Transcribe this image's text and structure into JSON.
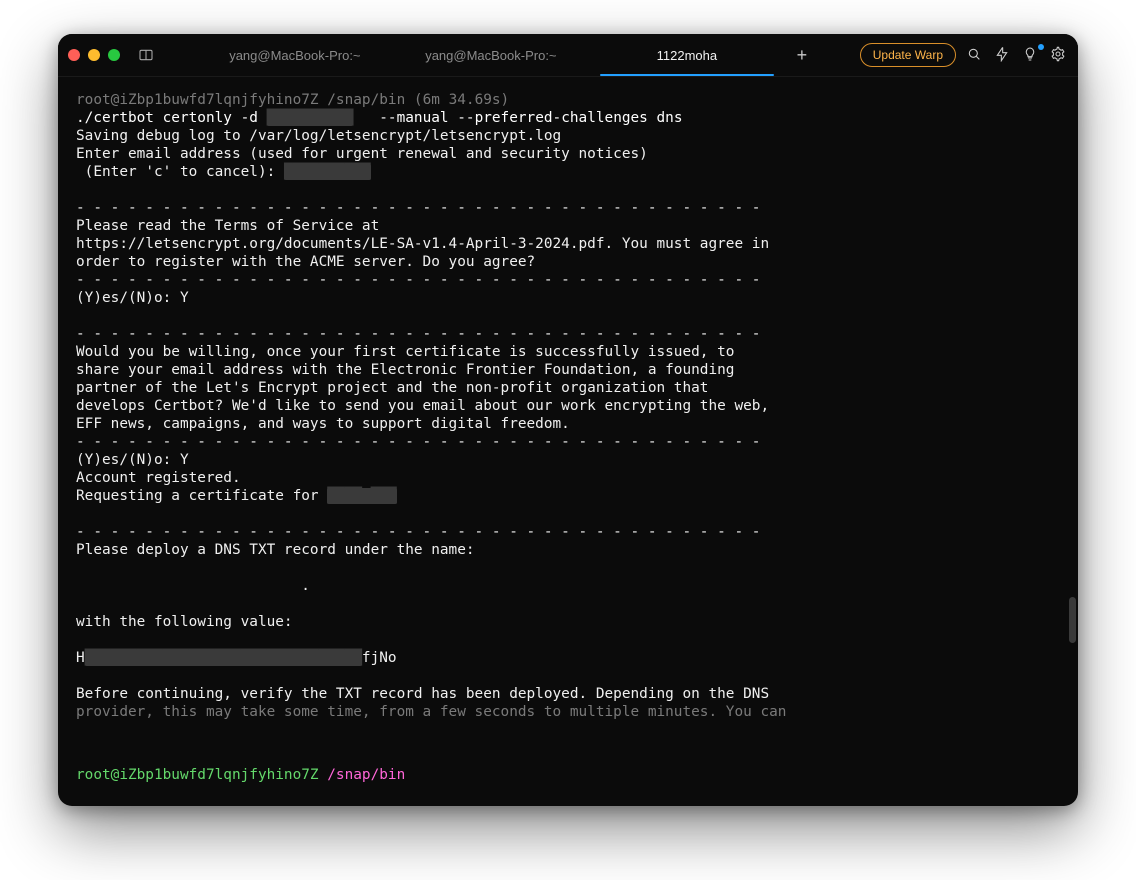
{
  "titlebar": {
    "tabs": [
      {
        "label": "yang@MacBook-Pro:~"
      },
      {
        "label": "yang@MacBook-Pro:~"
      },
      {
        "label": "1122moha"
      }
    ],
    "active_tab_index": 2,
    "update_label": "Update Warp",
    "newtab_glyph": "+"
  },
  "session": {
    "header_user_host": "root@iZbp1buwfd7lqnjfyhino7Z",
    "header_path": "/snap/bin",
    "header_timing": "(6m 34.69s)",
    "command_prefix": "./certbot certonly -d",
    "command_suffix": "--manual --preferred-challenges dns",
    "redacted_domain": "██████████",
    "lines": {
      "l1": "Saving debug log to /var/log/letsencrypt/letsencrypt.log",
      "l2": "Enter email address (used for urgent renewal and security notices)",
      "l3": " (Enter 'c' to cancel): ",
      "redacted_email": "██████████",
      "sep": "- - - - - - - - - - - - - - - - - - - - - - - - - - - - - - - - - - - - - - - -",
      "tos1": "Please read the Terms of Service at",
      "tos2": "https://letsencrypt.org/documents/LE-SA-v1.4-April-3-2024.pdf. You must agree in",
      "tos3": "order to register with the ACME server. Do you agree?",
      "yn1": "(Y)es/(N)o: Y",
      "eff1": "Would you be willing, once your first certificate is successfully issued, to",
      "eff2": "share your email address with the Electronic Frontier Foundation, a founding",
      "eff3": "partner of the Let's Encrypt project and the non-profit organization that",
      "eff4": "develops Certbot? We'd like to send you email about our work encrypting the web,",
      "eff5": "EFF news, campaigns, and ways to support digital freedom.",
      "yn2": "(Y)es/(N)o: Y",
      "acc": "Account registered.",
      "req": "Requesting a certificate for ",
      "redacted_cert_for": "████ ███",
      "dns1": "Please deploy a DNS TXT record under the name:",
      "dns_name_tail": ".",
      "withval": "with the following value:",
      "val_prefix": "H",
      "redacted_val_mid": "████████████████████████████████",
      "val_suffix": "fjNo",
      "before1": "Before continuing, verify the TXT record has been deployed. Depending on the DNS",
      "before2_partial": "provider, this may take some time, from a few seconds to multiple minutes. You can"
    }
  },
  "prompt": {
    "user_host": "root@iZbp1buwfd7lqnjfyhino7Z",
    "path_slash": "/snap/",
    "path_bin": "bin"
  },
  "icons": {
    "panel": "panel",
    "search": "search",
    "bolt": "bolt",
    "bulb": "bulb",
    "gear": "gear"
  }
}
